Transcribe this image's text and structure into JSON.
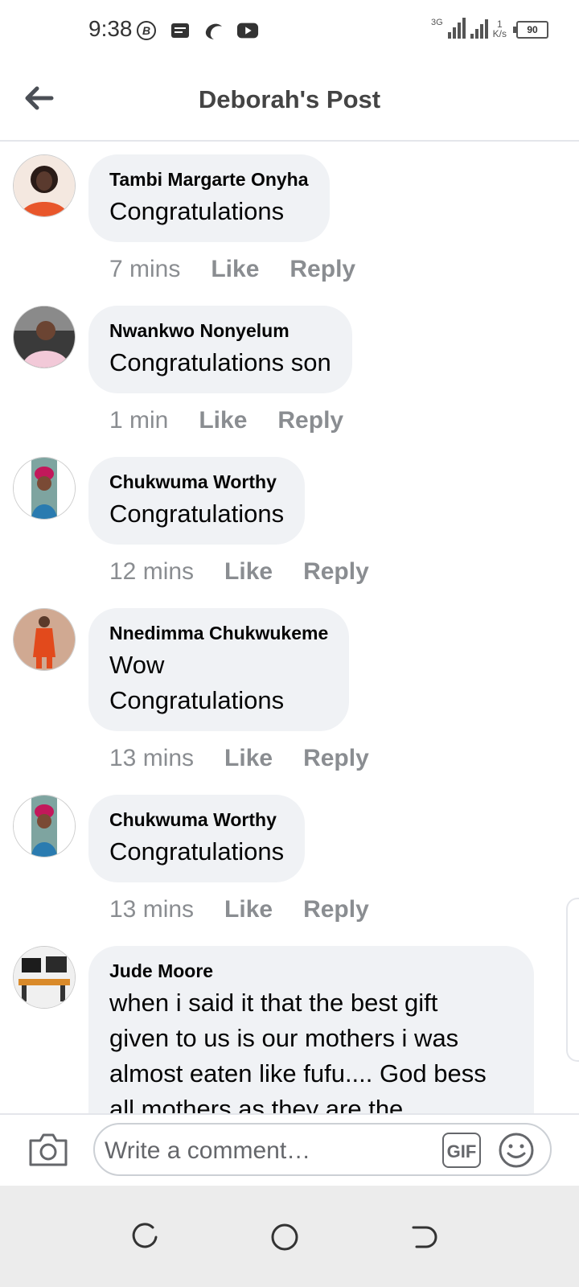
{
  "status": {
    "time": "9:38",
    "network_badge": "3G",
    "speed_value": "1",
    "speed_unit": "K/s",
    "battery": "90"
  },
  "header": {
    "title": "Deborah's Post"
  },
  "comments": [
    {
      "author": "Tambi Margarte Onyha",
      "lines": [
        "Congratulations"
      ],
      "time": "7 mins",
      "like": "Like",
      "reply": "Reply"
    },
    {
      "author": "Nwankwo Nonyelum",
      "lines": [
        "Congratulations son"
      ],
      "time": "1 min",
      "like": "Like",
      "reply": "Reply"
    },
    {
      "author": "Chukwuma Worthy",
      "lines": [
        "Congratulations"
      ],
      "time": "12 mins",
      "like": "Like",
      "reply": "Reply"
    },
    {
      "author": "Nnedimma Chukwukeme",
      "lines": [
        "Wow",
        "Congratulations"
      ],
      "time": "13 mins",
      "like": "Like",
      "reply": "Reply"
    },
    {
      "author": "Chukwuma Worthy",
      "lines": [
        "Congratulations"
      ],
      "time": "13 mins",
      "like": "Like",
      "reply": "Reply"
    },
    {
      "author": "Jude Moore",
      "lines": [
        "when i said it that the best gift",
        "given to us is our mothers i was",
        "almost eaten like fufu.... God bess",
        "all mothers as they are the"
      ]
    }
  ],
  "composer": {
    "placeholder": "Write a comment…",
    "gif_label": "GIF"
  },
  "colors": {
    "bubble": "#f0f2f5",
    "meta_text": "#8a8d91",
    "nav_bg": "#ececec"
  }
}
